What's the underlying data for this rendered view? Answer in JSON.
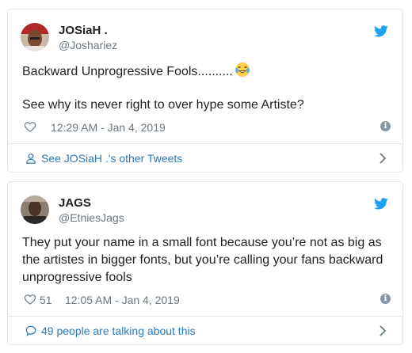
{
  "tweets": [
    {
      "display_name": "JOSiaH .",
      "handle": "@Joshariez",
      "text_line1": "Backward Unprogressive Fools..........",
      "text_line2": "See why its never right to over hype some Artiste?",
      "like_count": "",
      "timestamp": "12:29 AM - Jan 4, 2019",
      "footer_label": "See JOSiaH .'s other Tweets",
      "footer_icon": "person-icon",
      "emoji": "laughing-tears-emoji"
    },
    {
      "display_name": "JAGS",
      "handle": "@EtniesJags",
      "text": "They put your name in a small font because you’re not as big as the artistes in bigger fonts, but you’re calling your fans backward unprogressive fools",
      "like_count": "51",
      "timestamp": "12:05 AM - Jan 4, 2019",
      "footer_label": "49 people are talking about this",
      "footer_icon": "speech-bubble-icon"
    }
  ],
  "colors": {
    "accent": "#2b7bb9",
    "twitter_blue": "#1da1f2",
    "muted_text": "#697882",
    "border": "#e1e8ed"
  }
}
